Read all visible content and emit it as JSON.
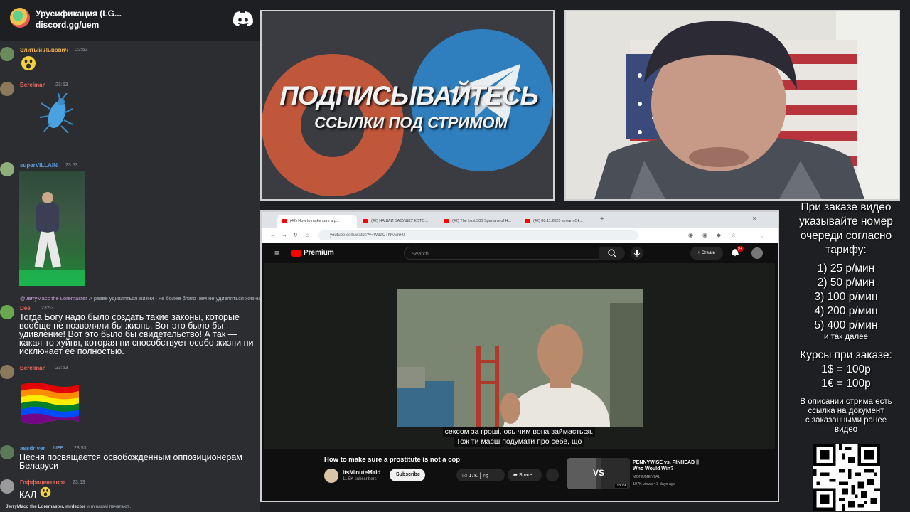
{
  "discord": {
    "server_name": "Урусификация (LG...",
    "server_link": "discord.gg/uem",
    "messages": [
      {
        "user": "Элитый Львович",
        "user_color": "#e8b04b",
        "time": "23:53",
        "content": "",
        "content_type": "emoji-face"
      },
      {
        "user": "Berelman",
        "user_color": "#ed6a5e",
        "time": "23:53",
        "content": "",
        "content_type": "cockroach-sticker"
      },
      {
        "user": "superVILLAIN",
        "user_color": "#5b9bd5",
        "time": "23:53",
        "content": "",
        "content_type": "dancing-video"
      },
      {
        "reply_user": "@JerryMacc the Loremaster",
        "reply_text": "А разве удивляться жизни - не более благо чем не удивляться жизни",
        "user": "Dee",
        "user_color": "#e86a5e",
        "time": "23:53",
        "content": "Тогда Богу надо было создать такие законы, которые вообще не позволяли бы жизнь. Вот это было бы удивление! Вот это было бы свидетельство! А так — какая-то хуйня, которая ни способствует особо жизни ни исключает её полностью."
      },
      {
        "user": "Berelman",
        "user_color": "#ed6a5e",
        "time": "23:53",
        "content": "",
        "content_type": "rainbow-flag"
      },
      {
        "user": "assdriver",
        "user_color": "#5b9bd5",
        "tag": "UEB",
        "time": "23:53",
        "content": "Песня посвящается освобожденным оппозиционерам Беларуси"
      },
      {
        "user": "Гоффоцентавра",
        "user_color": "#ed6a5e",
        "time": "23:53",
        "content": "КАЛ"
      }
    ],
    "typing": {
      "names": "JerryMacc the Loremaster, mrdector",
      "rest": " и minarski печатают..."
    }
  },
  "promo": {
    "headline": "ПОДПИСЫВАЙТЕСЬ",
    "subline": "ССЫЛКИ ПОД СТРИМОМ"
  },
  "browser": {
    "tabs": [
      {
        "label": "(42) How to make sure a p...",
        "active": true
      },
      {
        "label": "(42) НАШЛИ БАБУШКУ КОТО...",
        "active": false
      },
      {
        "label": "(42) The Lost 300 Spartans of H...",
        "active": false
      },
      {
        "label": "(42) 08.11.2025 stream Ok...",
        "active": false
      }
    ],
    "url": "youtube.com/watch?v=W3aCTNvAmF0",
    "youtube": {
      "logo_text": "Premium",
      "search_placeholder": "Search",
      "create_label": "Create",
      "notif_count": "9+",
      "subtitle_line1": "сексом за гроші, ось чим вона займається.",
      "subtitle_line2": "Тож ти маєш подумати про себе, що",
      "video_title": "How to make sure a prostitute is not a cop",
      "channel_name": "itsMinuteMaid",
      "channel_subs": "11.5K subscribers",
      "subscribe_label": "Subscribe",
      "likes": "17K",
      "share_label": "Share",
      "rec_title": "PENNYWISE vs. PINHEAD || Who Would Win?",
      "rec_channel": "MONUMENTAL",
      "rec_meta": "197K views • 3 days ago",
      "rec_duration": "13:19",
      "rec_vs": "VS"
    }
  },
  "info": {
    "order_text": [
      "При заказе видео",
      "указывайте номер",
      "очереди согласно",
      "тарифу:"
    ],
    "tariffs": [
      "1) 25 р/мин",
      "2) 50 р/мин",
      "3) 100 р/мин",
      "4) 200 р/мин",
      "5) 400 р/мин"
    ],
    "tariffs_more": "и так далее",
    "rates_title": "Курсы при заказе:",
    "rates": [
      "1$ = 100р",
      "1€ = 100р"
    ],
    "doc_text": [
      "В описании стрима есть",
      "ссылка на документ",
      "с заказанными ранее",
      "видео"
    ]
  }
}
